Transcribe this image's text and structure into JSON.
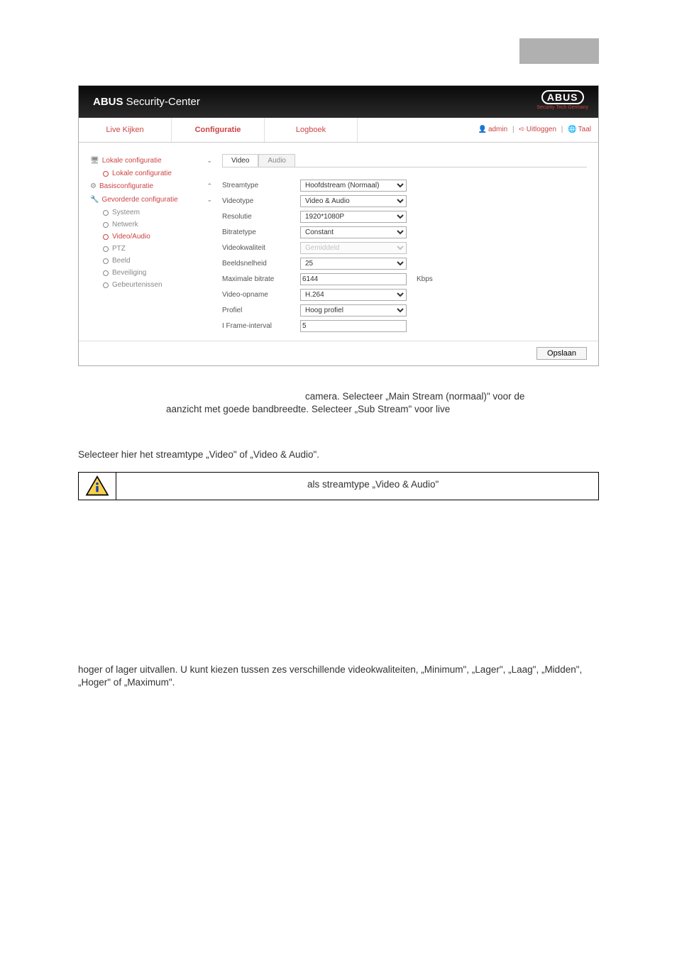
{
  "app": {
    "title_prefix": "ABUS",
    "title_suffix": " Security-Center",
    "logo_brand": "ABUS",
    "logo_sub": "Security Tech Germany"
  },
  "nav": {
    "tabs": [
      "Live Kijken",
      "Configuratie",
      "Logboek"
    ],
    "active_index": 1,
    "user_label": "admin",
    "logout_label": "Uitloggen",
    "lang_label": "Taal"
  },
  "sidebar": {
    "groups": [
      {
        "label": "Lokale configuratie",
        "state": "expanded-down",
        "items": [
          {
            "label": "Lokale configuratie",
            "active": false,
            "muted": false
          }
        ]
      },
      {
        "label": "Basisconfiguratie",
        "state": "collapsed-right",
        "items": []
      },
      {
        "label": "Gevorderde configuratie",
        "state": "expanded-down",
        "items": [
          {
            "label": "Systeem",
            "muted": true
          },
          {
            "label": "Netwerk",
            "muted": true
          },
          {
            "label": "Video/Audio",
            "muted": false,
            "active": true
          },
          {
            "label": "PTZ",
            "muted": true
          },
          {
            "label": "Beeld",
            "muted": true
          },
          {
            "label": "Beveiliging",
            "muted": true
          },
          {
            "label": "Gebeurtenissen",
            "muted": true
          }
        ]
      }
    ]
  },
  "content": {
    "tabs": [
      "Video",
      "Audio"
    ],
    "active_tab": 0,
    "rows": [
      {
        "label": "Streamtype",
        "type": "select",
        "value": "Hoofdstream (Normaal)"
      },
      {
        "label": "Videotype",
        "type": "select",
        "value": "Video & Audio"
      },
      {
        "label": "Resolutie",
        "type": "select",
        "value": "1920*1080P"
      },
      {
        "label": "Bitratetype",
        "type": "select",
        "value": "Constant"
      },
      {
        "label": "Videokwaliteit",
        "type": "select",
        "value": "Gemiddeld",
        "disabled": true
      },
      {
        "label": "Beeldsnelheid",
        "type": "select",
        "value": "25"
      },
      {
        "label": "Maximale bitrate",
        "type": "input",
        "value": "6144",
        "unit": "Kbps"
      },
      {
        "label": "Video-opname",
        "type": "select",
        "value": "H.264"
      },
      {
        "label": "Profiel",
        "type": "select",
        "value": "Hoog profiel"
      },
      {
        "label": "I Frame-interval",
        "type": "input",
        "value": "5"
      }
    ],
    "save_label": "Opslaan"
  },
  "doc": {
    "p1a": "camera. Selecteer „Main Stream (normaal)\" voor de",
    "p1b": "aanzicht met goede bandbreedte. Selecteer „Sub Stream\" voor live",
    "p2": "Selecteer hier het streamtype „Video\" of „Video & Audio\".",
    "note": "als streamtype „Video & Audio\"",
    "p3": "hoger of lager uitvallen. U kunt kiezen tussen zes verschillende videokwaliteiten, „Minimum\", „Lager\", „Laag\", „Midden\", „Hoger\" of „Maximum\"."
  }
}
